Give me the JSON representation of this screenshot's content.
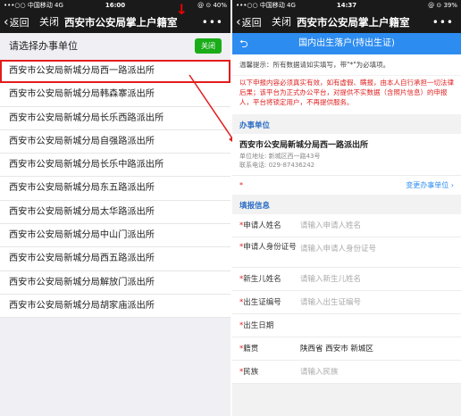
{
  "left": {
    "status": {
      "carrier": "•••○○ 中国移动  4G",
      "time": "16:00",
      "right": "@ ⊙ 40%"
    },
    "nav": {
      "back": "返回",
      "close": "关闭",
      "title": "西安市公安局掌上户籍室",
      "more": "•••"
    },
    "choose_title": "请选择办事单位",
    "close_button": "关闭",
    "stations": [
      "西安市公安局新城分局西一路派出所",
      "西安市公安局新城分局韩森寨派出所",
      "西安市公安局新城分局长乐西路派出所",
      "西安市公安局新城分局自强路派出所",
      "西安市公安局新城分局长乐中路派出所",
      "西安市公安局新城分局东五路派出所",
      "西安市公安局新城分局太华路派出所",
      "西安市公安局新城分局中山门派出所",
      "西安市公安局新城分局西五路派出所",
      "西安市公安局新城分局解放门派出所",
      "西安市公安局新城分局胡家庙派出所"
    ]
  },
  "right": {
    "status": {
      "carrier": "•••○○ 中国移动  4G",
      "time": "14:37",
      "right": "@ ⊙ 39%"
    },
    "nav": {
      "back": "返回",
      "close": "关闭",
      "title": "西安市公安局掌上户籍室",
      "more": "•••"
    },
    "header": "国内出生落户(持出生证)",
    "tip": "温馨提示：所有数据请如实填写，带\"*\"为必填项。",
    "warning": "以下申报内容必须真实有效，如有虚假、瞒报，由本人自行承担一切法律后果；该平台为正式办公平台，对提供不实数据（含照片信息）的申报人，平台将锁定用户，不再提供服务。",
    "unit_section": "办事单位",
    "unit_name": "西安市公安局新城分局西一路派出所",
    "unit_address": "单位地址: 新城区西一路43号",
    "unit_phone": "联系电话: 029-87436242",
    "change_star": "*",
    "change_link": "变更办事单位 ›",
    "fill_section": "填报信息",
    "fields": [
      {
        "label": "申请人姓名",
        "placeholder": "请输入申请人姓名"
      },
      {
        "label": "申请人身份证号",
        "placeholder": "请输入申请人身份证号"
      },
      {
        "label": "新生儿姓名",
        "placeholder": "请输入新生儿姓名"
      },
      {
        "label": "出生证编号",
        "placeholder": "请输入出生证编号"
      },
      {
        "label": "出生日期",
        "placeholder": ""
      },
      {
        "label": "籍贯",
        "value": "陕西省 西安市 新城区"
      },
      {
        "label": "民族",
        "placeholder": "请输入民族"
      }
    ]
  }
}
